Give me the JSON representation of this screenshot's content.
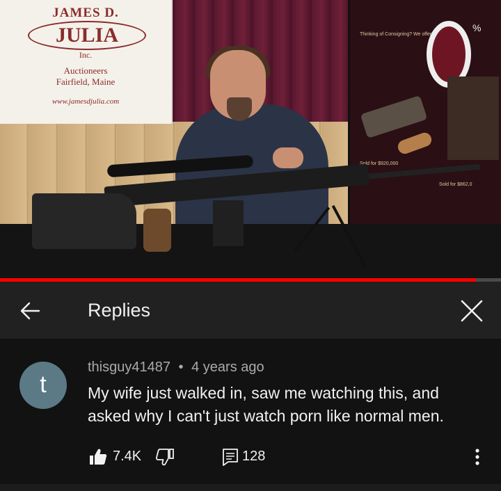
{
  "video": {
    "banner": {
      "line1": "JAMES D.",
      "line2": "JULIA",
      "line3": "Inc.",
      "line4": "Auctioneers",
      "line5": "Fairfield, Maine",
      "line6": "www.jamesdjulia.com"
    },
    "poster": {
      "heading": "Thinking of Consigning? We offer:",
      "sold1": "Sold for $920,000",
      "sold2": "Sold for $862,0"
    },
    "progress": 0.95,
    "progress_color": "#ff0000"
  },
  "header": {
    "back_icon": "arrow-left-icon",
    "title": "Replies",
    "close_icon": "close-icon"
  },
  "comment": {
    "avatar_letter": "t",
    "avatar_color": "#5b7a86",
    "author": "thisguy41487",
    "separator": "•",
    "time": "4 years ago",
    "text": "My wife just walked in, saw me watching this, and asked why I can't just watch porn like normal men.",
    "likes": "7.4K",
    "replies": "128",
    "icons": {
      "like": "thumbs-up-icon",
      "dislike": "thumbs-down-icon",
      "reply": "reply-icon",
      "more": "more-vertical-icon"
    }
  }
}
